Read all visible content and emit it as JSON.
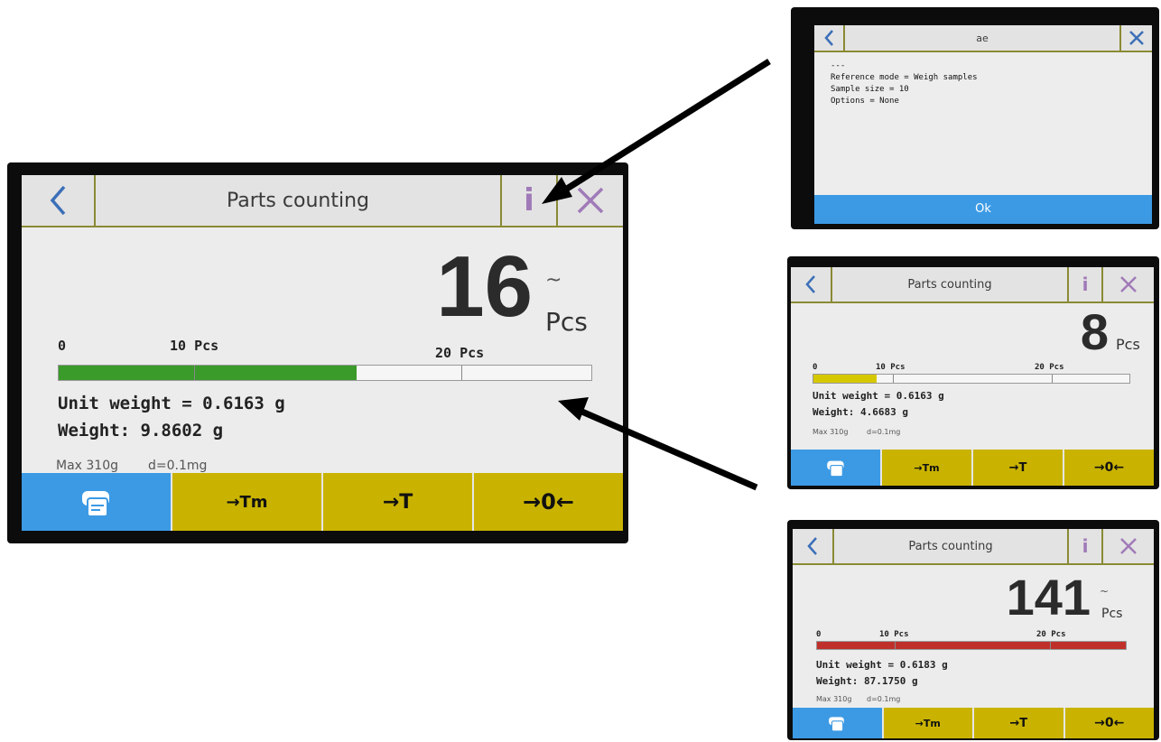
{
  "main": {
    "title": "Parts counting",
    "info_label": "i",
    "count": "16",
    "stable_mark": "~",
    "unit": "Pcs",
    "scale": {
      "zero": "0",
      "mid": "10 Pcs",
      "high": "20 Pcs"
    },
    "progress_fraction": 0.56,
    "progress_color": "#3a9a2a",
    "unit_weight": "Unit weight = 0.6163 g",
    "weight": "Weight: 9.8602 g",
    "max": "Max 310g",
    "division": "d=0.1mg",
    "buttons": [
      "→Tm",
      "→T",
      "→0←"
    ]
  },
  "info_dialog": {
    "title": "ae",
    "lines": [
      "---",
      "Reference mode = Weigh samples",
      "Sample size = 10",
      "Options = None"
    ],
    "ok_label": "Ok"
  },
  "small_yellow": {
    "title": "Parts counting",
    "info_label": "i",
    "count": "8",
    "unit": "Pcs",
    "scale": {
      "zero": "0",
      "mid": "10 Pcs",
      "high": "20 Pcs"
    },
    "progress_fraction": 0.2,
    "progress_color": "#d6c800",
    "unit_weight": "Unit weight = 0.6163 g",
    "weight": "Weight: 4.6683 g",
    "max": "Max 310g",
    "division": "d=0.1mg",
    "buttons": [
      "→Tm",
      "→T",
      "→0←"
    ]
  },
  "small_red": {
    "title": "Parts counting",
    "info_label": "i",
    "count": "141",
    "stable_mark": "~",
    "unit": "Pcs",
    "scale": {
      "zero": "0",
      "mid": "10 Pcs",
      "high": "20 Pcs"
    },
    "progress_fraction": 1.0,
    "progress_color": "#c0302a",
    "unit_weight": "Unit weight = 0.6183 g",
    "weight": "Weight: 87.1750 g",
    "max": "Max 310g",
    "division": "d=0.1mg",
    "buttons": [
      "→Tm",
      "→T",
      "→0←"
    ]
  },
  "colors": {
    "accent_blue": "#3c9ae4",
    "button_yellow": "#c9b300",
    "info_purple": "#a07ab8"
  }
}
